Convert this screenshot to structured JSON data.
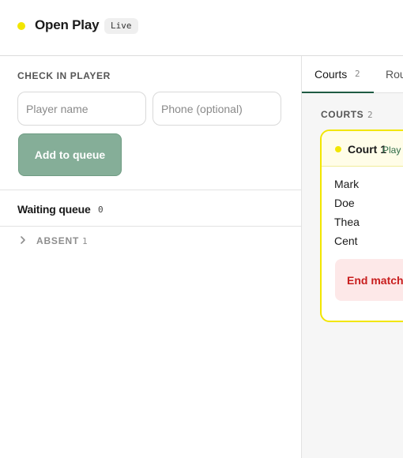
{
  "header": {
    "title": "Open Play",
    "badge": "Live"
  },
  "checkin": {
    "section_label": "CHECK IN PLAYER",
    "name_placeholder": "Player name",
    "phone_placeholder": "Phone (optional)",
    "add_label": "Add to queue"
  },
  "queue": {
    "title": "Waiting queue",
    "count": "0"
  },
  "absent": {
    "label": "ABSENT",
    "count": "1"
  },
  "tabs": [
    {
      "label": "Courts",
      "count": "2",
      "active": true
    },
    {
      "label": "Rou"
    }
  ],
  "courts_section": {
    "label": "COURTS",
    "count": "2"
  },
  "court": {
    "name": "Court 1",
    "status": "Play",
    "players": [
      "Mark",
      "Doe",
      "Thea",
      "Cent"
    ],
    "end_label": "End match"
  },
  "colors": {
    "live_dot": "#f2e600",
    "primary_button": "#85ae98",
    "active_tab": "#1f5b43",
    "court_border": "#f2e600",
    "danger_bg": "#fde8e8",
    "danger_text": "#c81e1e"
  },
  "icons": {
    "absent_toggle": "chevron-right-icon"
  }
}
